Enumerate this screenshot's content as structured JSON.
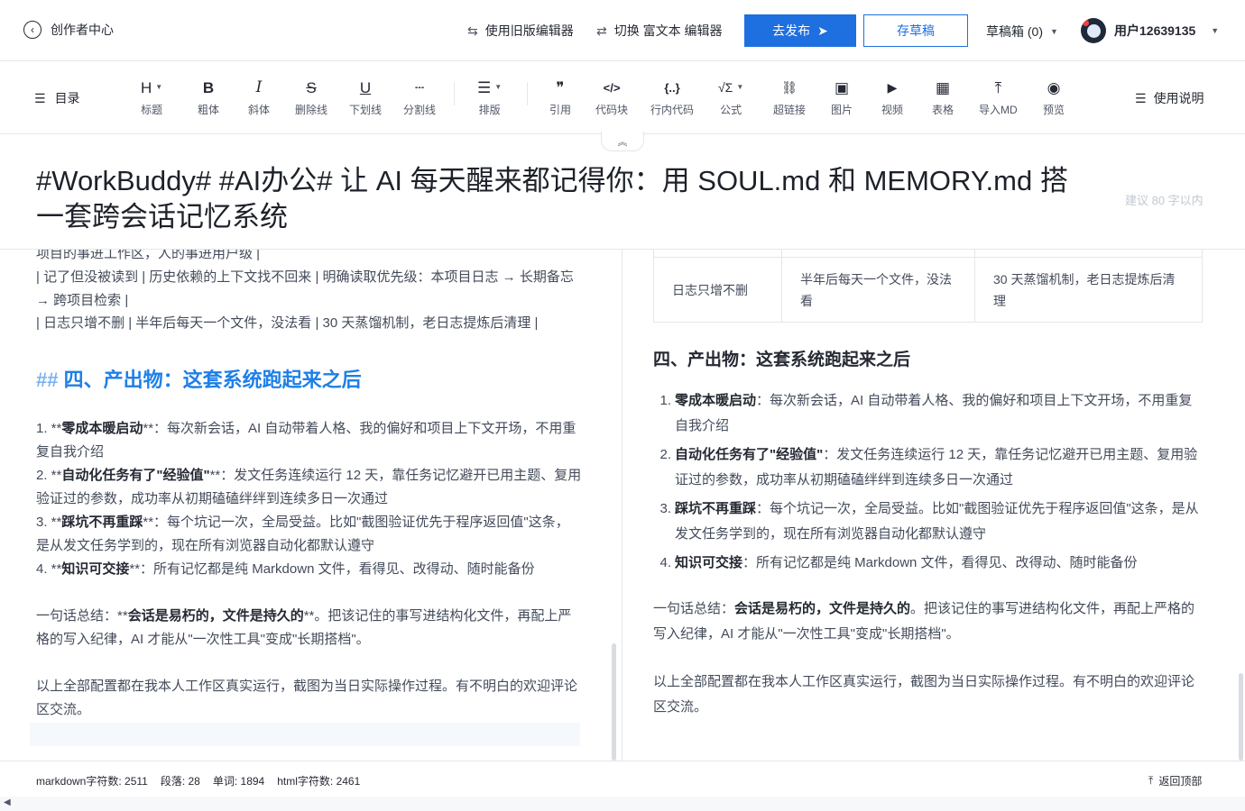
{
  "header": {
    "back_label": "创作者中心",
    "old_editor": "使用旧版编辑器",
    "switch_editor": "切换 富文本 编辑器",
    "publish": "去发布",
    "save_draft": "存草稿",
    "drafts": "草稿箱 (0)",
    "username": "用户12639135"
  },
  "toolbar": {
    "toc": "目录",
    "tools": [
      {
        "icon": "H",
        "label": "标题"
      },
      {
        "icon": "B",
        "label": "粗体"
      },
      {
        "icon": "I",
        "label": "斜体"
      },
      {
        "icon": "S",
        "label": "删除线"
      },
      {
        "icon": "U",
        "label": "下划线"
      },
      {
        "icon": "┄",
        "label": "分割线"
      },
      {
        "icon": "☰",
        "label": "排版"
      },
      {
        "icon": "❞",
        "label": "引用"
      },
      {
        "icon": "</>",
        "label": "代码块"
      },
      {
        "icon": "{..}",
        "label": "行内代码"
      },
      {
        "icon": "√Σ",
        "label": "公式"
      },
      {
        "icon": "⛓",
        "label": "超链接"
      },
      {
        "icon": "▣",
        "label": "图片"
      },
      {
        "icon": "▶",
        "label": "视频"
      },
      {
        "icon": "▦",
        "label": "表格"
      },
      {
        "icon": "⤒",
        "label": "导入MD"
      },
      {
        "icon": "◉",
        "label": "预览"
      }
    ],
    "help": "使用说明"
  },
  "article": {
    "title": "#WorkBuddy# #AI办公# 让 AI 每天醒来都记得你：用 SOUL.md 和 MEMORY.md 搭一套跨会话记忆系统",
    "title_hint": "建议 80 字以内"
  },
  "markdown": {
    "line_top": "项目的事进工作区，人的事进用户级 |",
    "row2": "| 记了但没被读到 | 历史依赖的上下文找不回来 | 明确读取优先级：本项目日志 → 长期备忘 → 跨项目检索 |",
    "row3": "| 日志只增不删 | 半年后每天一个文件，没法看 | 30 天蒸馏机制，老日志提炼后清理 |",
    "h2_mark": "##",
    "h2": "四、产出物：这套系统跑起来之后",
    "items": [
      {
        "pre": "1. **",
        "bold": "零成本暖启动",
        "post": "**：每次新会话，AI 自动带着人格、我的偏好和项目上下文开场，不用重复自我介绍"
      },
      {
        "pre": "2. **",
        "bold": "自动化任务有了\"经验值\"",
        "post": "**：发文任务连续运行 12 天，靠任务记忆避开已用主题、复用验证过的参数，成功率从初期磕磕绊绊到连续多日一次通过"
      },
      {
        "pre": "3. **",
        "bold": "踩坑不再重踩",
        "post": "**：每个坑记一次，全局受益。比如\"截图验证优先于程序返回值\"这条，是从发文任务学到的，现在所有浏览器自动化都默认遵守"
      },
      {
        "pre": "4. **",
        "bold": "知识可交接",
        "post": "**：所有记忆都是纯 Markdown 文件，看得见、改得动、随时能备份"
      }
    ],
    "summary_pre": "一句话总结：**",
    "summary_bold": "会话是易朽的，文件是持久的",
    "summary_post": "**。把该记住的事写进结构化文件，再配上严格的写入纪律，AI 才能从\"一次性工具\"变成\"长期搭档\"。",
    "closing": "以上全部配置都在我本人工作区真实运行，截图为当日实际操作过程。有不明白的欢迎评论区交流。"
  },
  "preview": {
    "table_row": [
      "日志只增不删",
      "半年后每天一个文件，没法看",
      "30 天蒸馏机制，老日志提炼后清理"
    ],
    "h2": "四、产出物：这套系统跑起来之后",
    "items": [
      {
        "num": "1.",
        "bold": "零成本暖启动",
        "text": "：每次新会话，AI 自动带着人格、我的偏好和项目上下文开场，不用重复自我介绍"
      },
      {
        "num": "2.",
        "bold": "自动化任务有了\"经验值\"",
        "text": "：发文任务连续运行 12 天，靠任务记忆避开已用主题、复用验证过的参数，成功率从初期磕磕绊绊到连续多日一次通过"
      },
      {
        "num": "3.",
        "bold": "踩坑不再重踩",
        "text": "：每个坑记一次，全局受益。比如\"截图验证优先于程序返回值\"这条，是从发文任务学到的，现在所有浏览器自动化都默认遵守"
      },
      {
        "num": "4.",
        "bold": "知识可交接",
        "text": "：所有记忆都是纯 Markdown 文件，看得见、改得动、随时能备份"
      }
    ],
    "summary_pre": "一句话总结：",
    "summary_bold": "会话是易朽的，文件是持久的",
    "summary_post": "。把该记住的事写进结构化文件，再配上严格的写入纪律，AI 才能从\"一次性工具\"变成\"长期搭档\"。",
    "closing": "以上全部配置都在我本人工作区真实运行，截图为当日实际操作过程。有不明白的欢迎评论区交流。"
  },
  "status": {
    "md_chars": "markdown字符数: 2511",
    "paragraphs": "段落: 28",
    "words": "单词: 1894",
    "html_chars": "html字符数: 2461",
    "back_to_top": "返回顶部"
  }
}
